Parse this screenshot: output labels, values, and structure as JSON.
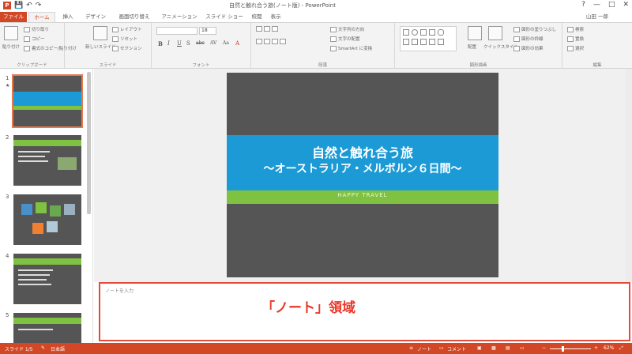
{
  "window": {
    "title": "自然と触れ合う旅(ノート版) - PowerPoint",
    "app_icon": "P",
    "help": "?",
    "minimize": "—",
    "maximize": "□",
    "close": "✕"
  },
  "qat": {
    "save_icon": "💾",
    "undo_icon": "↶",
    "redo_icon": "↷"
  },
  "tabs": {
    "file": "ファイル",
    "home": "ホーム",
    "insert": "挿入",
    "design": "デザイン",
    "transitions": "画面切り替え",
    "animations": "アニメーション",
    "slideshow": "スライド ショー",
    "review": "校閲",
    "view": "表示",
    "user": "山田 一郎"
  },
  "ribbon": {
    "clipboard": {
      "label": "クリップボード",
      "paste": "貼り付け",
      "cut": "切り取り",
      "copy": "コピー",
      "painter": "書式のコピー/貼り付け"
    },
    "slides": {
      "label": "スライド",
      "new_slide": "新しいスライド",
      "layout": "レイアウト",
      "reset": "リセット",
      "section": "セクション"
    },
    "font": {
      "label": "フォント",
      "size": "18",
      "bold": "B",
      "italic": "I",
      "underline": "U",
      "shadow": "S",
      "strike": "abc",
      "spacing": "AV",
      "case": "Aa",
      "color": "A"
    },
    "paragraph": {
      "label": "段落",
      "direction": "文字列の方向",
      "align": "文字の配置",
      "smartart": "SmartArt に変換"
    },
    "drawing": {
      "label": "図形描画",
      "arrange": "配置",
      "quick_styles": "クイックスタイル",
      "fill": "図形の塗りつぶし",
      "outline": "図形の枠線",
      "effects": "図形の効果"
    },
    "editing": {
      "label": "編集",
      "find": "検索",
      "replace": "置換",
      "select": "選択"
    }
  },
  "thumbnails": [
    {
      "num": "1",
      "star": "★"
    },
    {
      "num": "2",
      "star": ""
    },
    {
      "num": "3",
      "star": ""
    },
    {
      "num": "4",
      "star": ""
    },
    {
      "num": "5",
      "star": ""
    }
  ],
  "slide": {
    "title": "自然と触れ合う旅",
    "subtitle": "～オーストラリア・メルボルン６日間～",
    "tagline": "HAPPY TRAVEL"
  },
  "notes": {
    "placeholder": "ノートを入力",
    "callout": "「ノート」領域"
  },
  "status": {
    "slide": "スライド 1/5",
    "language": "日本語",
    "notes_btn": "ノート",
    "comments_btn": "コメント",
    "zoom": "62%",
    "zoom_value": 0.62
  },
  "colors": {
    "accent": "#d24726",
    "slide_bg": "#555555",
    "slide_band": "#1c9ad6",
    "slide_green": "#7fc242",
    "notes_border": "#e84a3a"
  }
}
